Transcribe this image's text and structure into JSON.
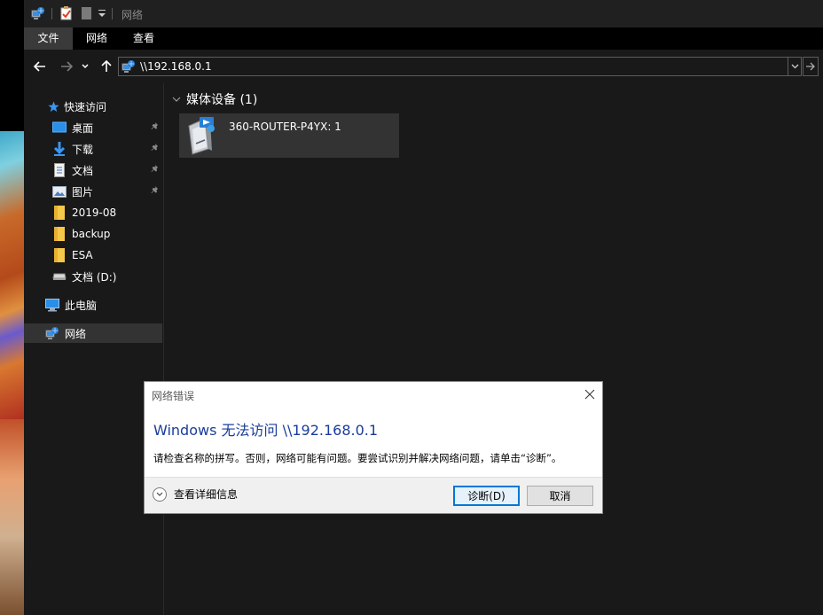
{
  "window": {
    "title": "网络",
    "quick_access_icons": [
      "network-icon",
      "properties-icon",
      "new-folder-icon",
      "customize-dropdown-icon"
    ]
  },
  "ribbon": {
    "tabs": [
      {
        "label": "文件",
        "active": true
      },
      {
        "label": "网络",
        "active": false
      },
      {
        "label": "查看",
        "active": false
      }
    ]
  },
  "navigation": {
    "address": "\\\\192.168.0.1"
  },
  "sidebar": {
    "quick_access": "快速访问",
    "items": [
      {
        "label": "桌面",
        "icon": "desktop-icon",
        "pinned": true
      },
      {
        "label": "下载",
        "icon": "download-icon",
        "pinned": true
      },
      {
        "label": "文档",
        "icon": "documents-icon",
        "pinned": true
      },
      {
        "label": "图片",
        "icon": "pictures-icon",
        "pinned": true
      },
      {
        "label": "2019-08",
        "icon": "folder-icon",
        "pinned": false
      },
      {
        "label": "backup",
        "icon": "folder-icon",
        "pinned": false
      },
      {
        "label": "ESA",
        "icon": "folder-icon",
        "pinned": false
      },
      {
        "label": "文档 (D:)",
        "icon": "drive-icon",
        "pinned": false
      }
    ],
    "this_pc": "此电脑",
    "network": "网络"
  },
  "content": {
    "group_header": "媒体设备 (1)",
    "devices": [
      {
        "label": "360-ROUTER-P4YX: 1",
        "icon": "media-device-icon"
      }
    ]
  },
  "dialog": {
    "title": "网络错误",
    "heading": "Windows 无法访问 \\\\192.168.0.1",
    "message": "请检查名称的拼写。否则，网络可能有问题。要尝试识别并解决网络问题，请单击“诊断”。",
    "details_label": "查看详细信息",
    "diagnose_label": "诊断(D)",
    "cancel_label": "取消"
  },
  "colors": {
    "accent": "#0078d7",
    "dialog_heading": "#1a3c9c",
    "pane_background": "#191919"
  }
}
